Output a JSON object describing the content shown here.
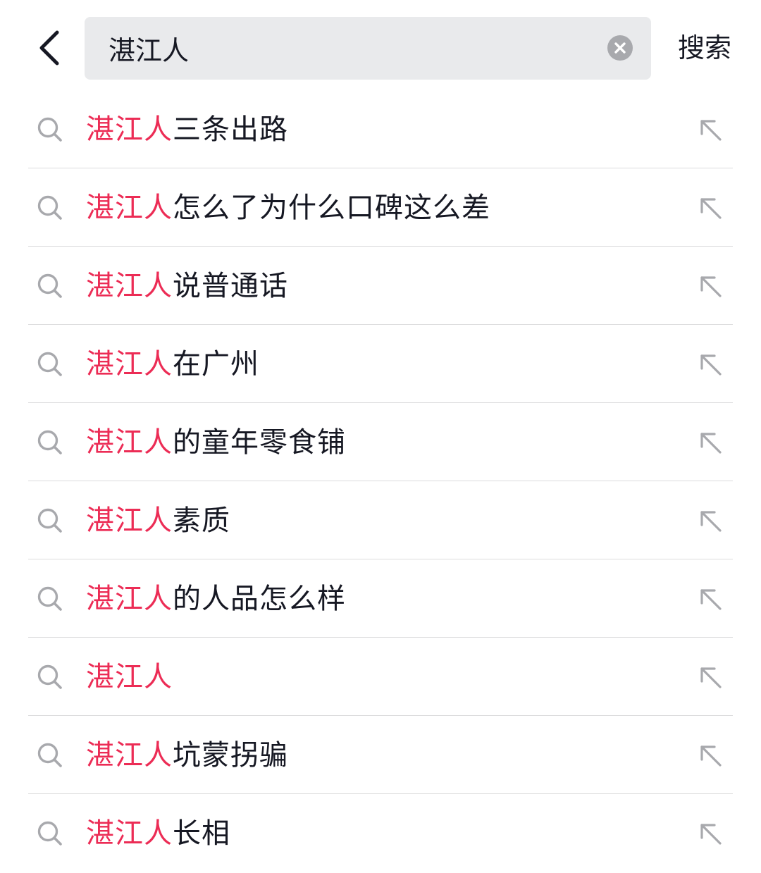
{
  "header": {
    "back_icon": "chevron-left-icon",
    "search_value": "湛江人",
    "clear_icon": "clear-circle-icon",
    "search_button_label": "搜索"
  },
  "colors": {
    "highlight": "#ec2c55",
    "text": "#161823",
    "search_bg": "#e9eaec",
    "divider": "#dcdcdd",
    "icon": "#a8a9ad"
  },
  "suggestions": [
    {
      "highlight": "湛江人",
      "rest": "三条出路"
    },
    {
      "highlight": "湛江人",
      "rest": "怎么了为什么口碑这么差"
    },
    {
      "highlight": "湛江人",
      "rest": "说普通话"
    },
    {
      "highlight": "湛江人",
      "rest": "在广州"
    },
    {
      "highlight": "湛江人",
      "rest": "的童年零食铺"
    },
    {
      "highlight": "湛江人",
      "rest": "素质"
    },
    {
      "highlight": "湛江人",
      "rest": "的人品怎么样"
    },
    {
      "highlight": "湛江人",
      "rest": ""
    },
    {
      "highlight": "湛江人",
      "rest": "坑蒙拐骗"
    },
    {
      "highlight": "湛江人",
      "rest": "长相"
    }
  ]
}
